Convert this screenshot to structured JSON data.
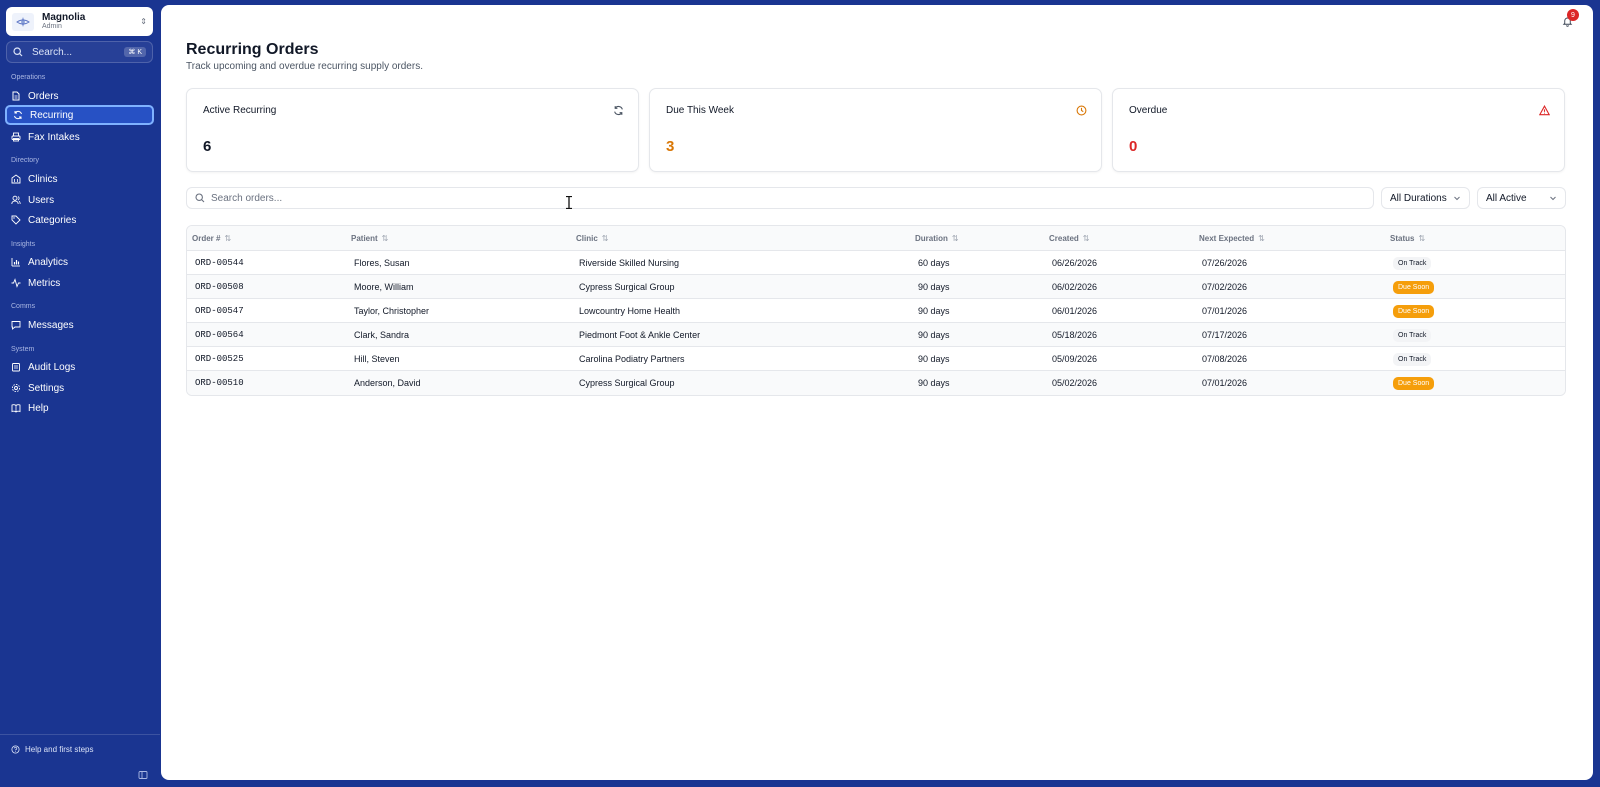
{
  "brand": {
    "name": "Magnolia",
    "role": "Admin"
  },
  "sidebar_search": {
    "label": "Search...",
    "shortcut": "⌘ K"
  },
  "sections": {
    "operations": "Operations",
    "directory": "Directory",
    "insights": "Insights",
    "comms": "Comms",
    "system": "System"
  },
  "nav": {
    "orders": "Orders",
    "recurring": "Recurring",
    "fax_intakes": "Fax Intakes",
    "clinics": "Clinics",
    "users": "Users",
    "categories": "Categories",
    "analytics": "Analytics",
    "metrics": "Metrics",
    "messages": "Messages",
    "audit_logs": "Audit Logs",
    "settings": "Settings",
    "help": "Help"
  },
  "footer": {
    "help_first_steps": "Help and first steps"
  },
  "notifications": {
    "count": "9"
  },
  "page": {
    "title": "Recurring Orders",
    "subtitle": "Track upcoming and overdue recurring supply orders."
  },
  "stats": {
    "active": {
      "title": "Active Recurring",
      "value": "6"
    },
    "due": {
      "title": "Due This Week",
      "value": "3"
    },
    "overdue": {
      "title": "Overdue",
      "value": "0"
    }
  },
  "filters": {
    "search_placeholder": "Search orders...",
    "duration": "All Durations",
    "status": "All Active"
  },
  "table": {
    "headers": {
      "order": "Order #",
      "patient": "Patient",
      "clinic": "Clinic",
      "duration": "Duration",
      "created": "Created",
      "next": "Next Expected",
      "status": "Status"
    },
    "rows": [
      {
        "order": "ORD-00544",
        "patient": "Flores, Susan",
        "clinic": "Riverside Skilled Nursing",
        "duration": "60 days",
        "created": "06/26/2026",
        "next": "07/26/2026",
        "status": "On Track"
      },
      {
        "order": "ORD-00508",
        "patient": "Moore, William",
        "clinic": "Cypress Surgical Group",
        "duration": "90 days",
        "created": "06/02/2026",
        "next": "07/02/2026",
        "status": "Due Soon"
      },
      {
        "order": "ORD-00547",
        "patient": "Taylor, Christopher",
        "clinic": "Lowcountry Home Health",
        "duration": "90 days",
        "created": "06/01/2026",
        "next": "07/01/2026",
        "status": "Due Soon"
      },
      {
        "order": "ORD-00564",
        "patient": "Clark, Sandra",
        "clinic": "Piedmont Foot & Ankle Center",
        "duration": "90 days",
        "created": "05/18/2026",
        "next": "07/17/2026",
        "status": "On Track"
      },
      {
        "order": "ORD-00525",
        "patient": "Hill, Steven",
        "clinic": "Carolina Podiatry Partners",
        "duration": "90 days",
        "created": "05/09/2026",
        "next": "07/08/2026",
        "status": "On Track"
      },
      {
        "order": "ORD-00510",
        "patient": "Anderson, David",
        "clinic": "Cypress Surgical Group",
        "duration": "90 days",
        "created": "05/02/2026",
        "next": "07/01/2026",
        "status": "Due Soon"
      }
    ]
  },
  "colors": {
    "sidebar": "#1a3591",
    "due_accent": "#d97706",
    "overdue_accent": "#dc2626",
    "due_soon_badge": "#f59e0b"
  }
}
